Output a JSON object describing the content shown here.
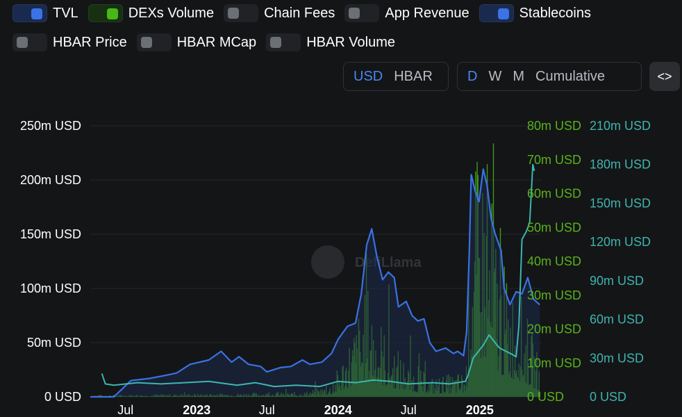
{
  "toggles": [
    {
      "label": "TVL",
      "on": true,
      "color": "#3b72e4"
    },
    {
      "label": "DEXs Volume",
      "on": true,
      "color": "#47b818"
    },
    {
      "label": "Chain Fees",
      "on": false
    },
    {
      "label": "App Revenue",
      "on": false
    },
    {
      "label": "Stablecoins",
      "on": true,
      "color": "#3b72e4"
    },
    {
      "label": "HBAR Price",
      "on": false
    },
    {
      "label": "HBAR MCap",
      "on": false
    },
    {
      "label": "HBAR Volume",
      "on": false
    }
  ],
  "denomination": {
    "options": [
      "USD",
      "HBAR"
    ],
    "selected": "USD"
  },
  "period": {
    "options": [
      "D",
      "W",
      "M",
      "Cumulative"
    ],
    "selected": "D"
  },
  "embed_label": "<>",
  "watermark": "DefiLlama",
  "colors": {
    "background": "#141517",
    "tvl_line": "#3a72e4",
    "tvl_fill": "#1b2a4c",
    "dex_bars": "#3d9a1a",
    "stablecoin_line": "#3cb7b0",
    "axis_green": "#59b21a",
    "axis_teal": "#3fb4ae",
    "active": "#4a86f0"
  },
  "chart_data": {
    "type": "line",
    "x_ticks": [
      {
        "label": "Jul",
        "date": "2022-07",
        "bold": false
      },
      {
        "label": "2023",
        "date": "2023-01",
        "bold": true
      },
      {
        "label": "Jul",
        "date": "2023-07",
        "bold": false
      },
      {
        "label": "2024",
        "date": "2024-01",
        "bold": true
      },
      {
        "label": "Jul",
        "date": "2024-07",
        "bold": false
      },
      {
        "label": "2025",
        "date": "2025-01",
        "bold": true
      }
    ],
    "axes": {
      "left": {
        "ticks": [
          "0 USD",
          "50m USD",
          "100m USD",
          "150m USD",
          "200m USD",
          "250m USD"
        ],
        "range": [
          0,
          250
        ]
      },
      "green": {
        "ticks": [
          "0 USD",
          "10m USD",
          "20m USD",
          "30m USD",
          "40m USD",
          "50m USD",
          "60m USD",
          "70m USD",
          "80m USD"
        ],
        "range": [
          0,
          80
        ]
      },
      "teal": {
        "ticks": [
          "0 USD",
          "30m USD",
          "60m USD",
          "90m USD",
          "120m USD",
          "150m USD",
          "180m USD",
          "210m USD"
        ],
        "range": [
          0,
          210
        ]
      }
    },
    "grid": true,
    "series": [
      {
        "name": "TVL",
        "unit": "m USD",
        "axis": "left",
        "points": [
          [
            "2022-04-01",
            0
          ],
          [
            "2022-06-01",
            0
          ],
          [
            "2022-07-15",
            15
          ],
          [
            "2022-09-01",
            17
          ],
          [
            "2022-10-15",
            20
          ],
          [
            "2022-11-10",
            22
          ],
          [
            "2022-12-15",
            30
          ],
          [
            "2023-02-01",
            34
          ],
          [
            "2023-03-05",
            42
          ],
          [
            "2023-04-01",
            32
          ],
          [
            "2023-04-20",
            37
          ],
          [
            "2023-05-15",
            30
          ],
          [
            "2023-06-15",
            28
          ],
          [
            "2023-07-01",
            23
          ],
          [
            "2023-08-05",
            27
          ],
          [
            "2023-09-01",
            28
          ],
          [
            "2023-10-01",
            34
          ],
          [
            "2023-10-20",
            30
          ],
          [
            "2023-11-20",
            32
          ],
          [
            "2023-12-15",
            40
          ],
          [
            "2024-01-01",
            53
          ],
          [
            "2024-01-25",
            65
          ],
          [
            "2024-02-15",
            68
          ],
          [
            "2024-03-01",
            95
          ],
          [
            "2024-03-15",
            140
          ],
          [
            "2024-03-28",
            155
          ],
          [
            "2024-04-10",
            130
          ],
          [
            "2024-04-25",
            108
          ],
          [
            "2024-05-10",
            115
          ],
          [
            "2024-05-25",
            110
          ],
          [
            "2024-06-05",
            83
          ],
          [
            "2024-06-25",
            88
          ],
          [
            "2024-07-10",
            75
          ],
          [
            "2024-07-25",
            70
          ],
          [
            "2024-08-10",
            72
          ],
          [
            "2024-08-25",
            50
          ],
          [
            "2024-09-10",
            42
          ],
          [
            "2024-10-05",
            45
          ],
          [
            "2024-10-25",
            40
          ],
          [
            "2024-11-05",
            42
          ],
          [
            "2024-11-20",
            38
          ],
          [
            "2024-11-28",
            60
          ],
          [
            "2024-12-05",
            135
          ],
          [
            "2024-12-10",
            205
          ],
          [
            "2024-12-20",
            190
          ],
          [
            "2024-12-30",
            180
          ],
          [
            "2025-01-10",
            210
          ],
          [
            "2025-01-20",
            195
          ],
          [
            "2025-01-30",
            165
          ],
          [
            "2025-02-10",
            150
          ],
          [
            "2025-02-25",
            135
          ],
          [
            "2025-03-05",
            100
          ],
          [
            "2025-03-20",
            85
          ],
          [
            "2025-04-05",
            97
          ],
          [
            "2025-04-20",
            95
          ],
          [
            "2025-05-05",
            110
          ],
          [
            "2025-05-20",
            90
          ],
          [
            "2025-06-05",
            85
          ]
        ]
      },
      {
        "name": "Stablecoins",
        "unit": "m USD",
        "axis": "teal",
        "points": [
          [
            "2022-05-01",
            18
          ],
          [
            "2022-05-10",
            10
          ],
          [
            "2022-06-01",
            9
          ],
          [
            "2022-08-01",
            11
          ],
          [
            "2022-10-01",
            10
          ],
          [
            "2022-12-01",
            11
          ],
          [
            "2023-02-01",
            12
          ],
          [
            "2023-04-15",
            9
          ],
          [
            "2023-06-01",
            11
          ],
          [
            "2023-07-20",
            8
          ],
          [
            "2023-09-15",
            9
          ],
          [
            "2023-11-15",
            8
          ],
          [
            "2024-01-01",
            12
          ],
          [
            "2024-02-15",
            11
          ],
          [
            "2024-04-01",
            13
          ],
          [
            "2024-05-15",
            12
          ],
          [
            "2024-07-01",
            10
          ],
          [
            "2024-09-01",
            11
          ],
          [
            "2024-10-15",
            10
          ],
          [
            "2024-11-25",
            12
          ],
          [
            "2024-12-01",
            16
          ],
          [
            "2024-12-15",
            30
          ],
          [
            "2025-01-10",
            40
          ],
          [
            "2025-01-25",
            48
          ],
          [
            "2025-02-20",
            38
          ],
          [
            "2025-03-05",
            36
          ],
          [
            "2025-03-25",
            33
          ],
          [
            "2025-04-05",
            31
          ],
          [
            "2025-04-12",
            55
          ],
          [
            "2025-04-20",
            122
          ],
          [
            "2025-05-01",
            128
          ],
          [
            "2025-05-10",
            135
          ],
          [
            "2025-05-18",
            180
          ],
          [
            "2025-05-22",
            175
          ]
        ]
      },
      {
        "name": "DEXs Volume",
        "unit": "m USD",
        "axis": "green",
        "type": "bar",
        "envelope": [
          [
            "2022-04-01",
            0.5
          ],
          [
            "2023-10-01",
            1.5
          ],
          [
            "2023-12-15",
            4
          ],
          [
            "2024-03-20",
            35
          ],
          [
            "2024-05-01",
            20
          ],
          [
            "2024-07-01",
            10
          ],
          [
            "2024-09-01",
            6
          ],
          [
            "2024-11-25",
            8
          ],
          [
            "2024-12-10",
            68
          ],
          [
            "2025-01-10",
            75
          ],
          [
            "2025-03-01",
            40
          ],
          [
            "2025-04-20",
            30
          ],
          [
            "2025-06-05",
            10
          ]
        ]
      }
    ]
  }
}
